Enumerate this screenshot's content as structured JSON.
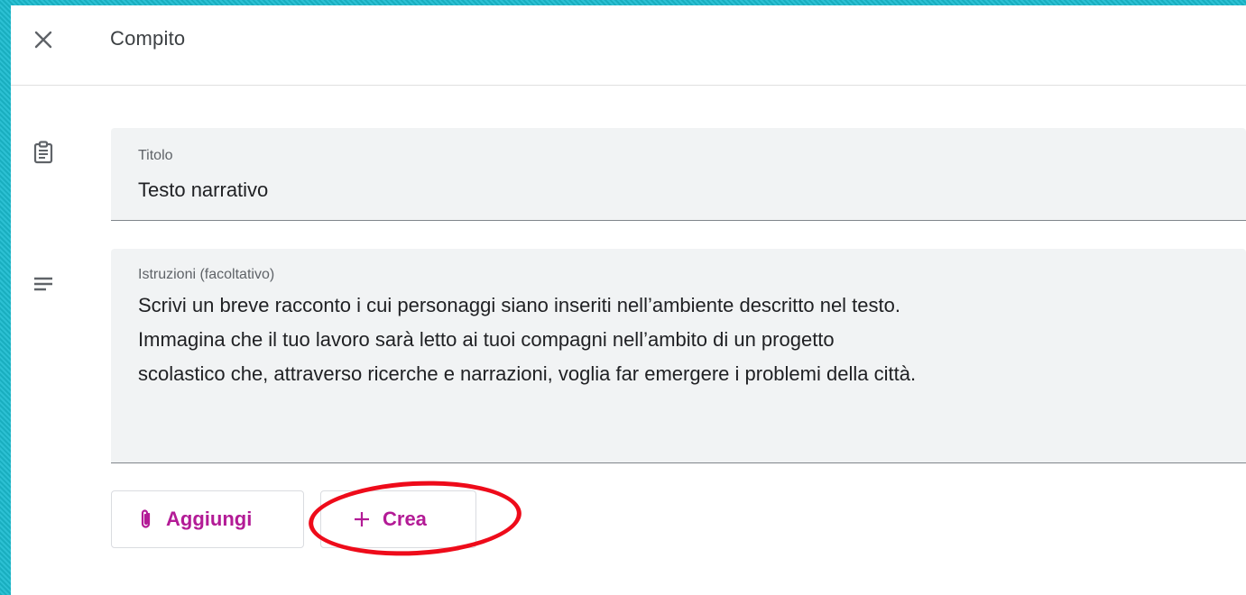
{
  "header": {
    "title": "Compito",
    "close_icon": "close-icon"
  },
  "title_field": {
    "icon": "assignment-icon",
    "label": "Titolo",
    "value": "Testo narrativo"
  },
  "instructions_field": {
    "icon": "notes-icon",
    "label": "Istruzioni (facoltativo)",
    "value": "Scrivi un breve racconto i cui personaggi siano inseriti nell’ambiente descritto nel testo.\nImmagina che il tuo lavoro sarà letto ai tuoi compagni nell’ambito di un progetto\nscolastico che, attraverso ricerche e narrazioni, voglia far emergere i problemi della città."
  },
  "actions": {
    "add_label": "Aggiungi",
    "add_icon": "paperclip-icon",
    "create_label": "Crea",
    "create_icon": "plus-icon"
  },
  "colors": {
    "accent": "#b31b96",
    "highlight": "#ee0b1a",
    "frame": "#1fb4c8"
  }
}
